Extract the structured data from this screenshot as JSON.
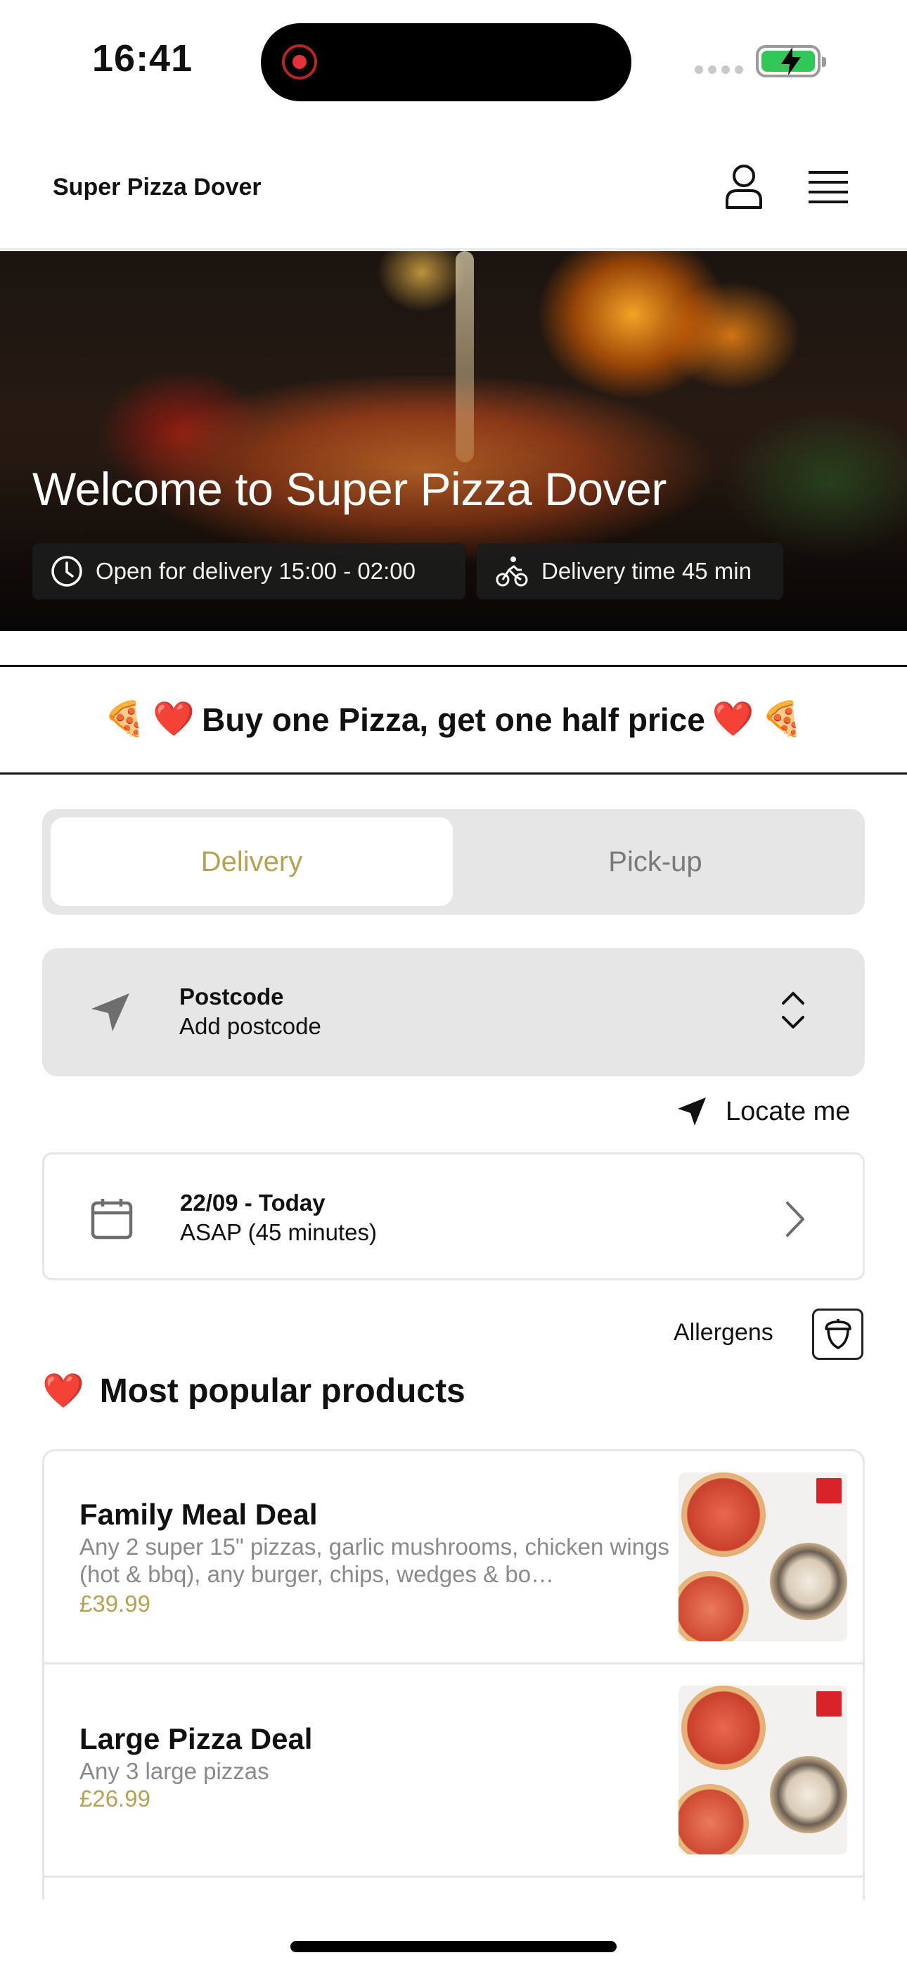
{
  "status_bar": {
    "time": "16:41"
  },
  "header": {
    "brand": "Super Pizza Dover",
    "icons": [
      "user-icon",
      "menu-icon"
    ]
  },
  "hero": {
    "title": "Welcome to Super Pizza Dover",
    "open_chip": "Open for delivery 15:00 - 02:00",
    "delivery_chip": "Delivery time 45 min"
  },
  "promo": {
    "text": "Buy one Pizza, get one half price",
    "emoji_left": [
      "🍕",
      "❤️"
    ],
    "emoji_right": [
      "❤️",
      "🍕"
    ]
  },
  "order_mode": {
    "options": [
      "Delivery",
      "Pick-up"
    ],
    "selected": "Delivery",
    "accent": "#b6a254"
  },
  "postcode": {
    "label": "Postcode",
    "placeholder": "Add postcode"
  },
  "locate": {
    "label": "Locate me"
  },
  "schedule": {
    "date": "22/09 - Today",
    "time": "ASAP (45 minutes)"
  },
  "allergens": {
    "label": "Allergens"
  },
  "popular": {
    "title": "Most popular products",
    "emoji": "❤️",
    "products": [
      {
        "name": "Family Meal Deal",
        "description": "Any 2 super 15\" pizzas, garlic mushrooms, chicken wings (hot & bbq), any burger, chips, wedges & bo…",
        "price": "£39.99"
      },
      {
        "name": "Large Pizza Deal",
        "description": "Any 3 large pizzas",
        "price": "£26.99"
      }
    ]
  }
}
